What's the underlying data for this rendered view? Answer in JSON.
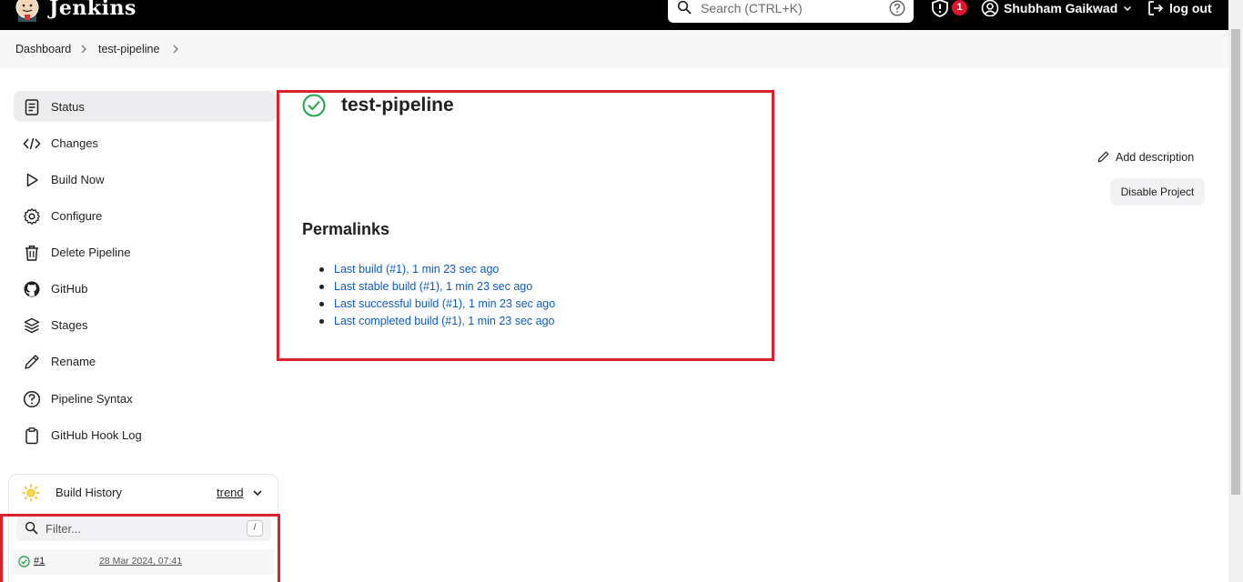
{
  "header": {
    "brand": "Jenkins",
    "search_placeholder": "Search (CTRL+K)",
    "alert_count": "1",
    "user_name": "Shubham Gaikwad",
    "logout_label": "log out"
  },
  "breadcrumb": {
    "items": [
      "Dashboard",
      "test-pipeline"
    ]
  },
  "sidebar": {
    "items": [
      {
        "label": "Status",
        "icon": "document-icon"
      },
      {
        "label": "Changes",
        "icon": "code-icon"
      },
      {
        "label": "Build Now",
        "icon": "play-icon"
      },
      {
        "label": "Configure",
        "icon": "gear-icon"
      },
      {
        "label": "Delete Pipeline",
        "icon": "trash-icon"
      },
      {
        "label": "GitHub",
        "icon": "github-icon"
      },
      {
        "label": "Stages",
        "icon": "layers-icon"
      },
      {
        "label": "Rename",
        "icon": "pencil-icon"
      },
      {
        "label": "Pipeline Syntax",
        "icon": "help-icon"
      },
      {
        "label": "GitHub Hook Log",
        "icon": "clipboard-icon"
      }
    ]
  },
  "build_history": {
    "title": "Build History",
    "trend_label": "trend",
    "filter_placeholder": "Filter...",
    "filter_shortcut": "/",
    "builds": [
      {
        "number": "#1",
        "date": "28 Mar 2024, 07:41"
      }
    ]
  },
  "main": {
    "title": "test-pipeline",
    "permalinks_heading": "Permalinks",
    "permalinks": [
      "Last build (#1), 1 min 23 sec ago",
      "Last stable build (#1), 1 min 23 sec ago",
      "Last successful build (#1), 1 min 23 sec ago",
      "Last completed build (#1), 1 min 23 sec ago"
    ],
    "add_description_label": "Add description",
    "disable_project_label": "Disable Project"
  },
  "colors": {
    "header_bg": "#000000",
    "link": "#0b5cc4",
    "success": "#1ea64b",
    "highlight": "#d9212c",
    "badge": "#e0142b"
  }
}
